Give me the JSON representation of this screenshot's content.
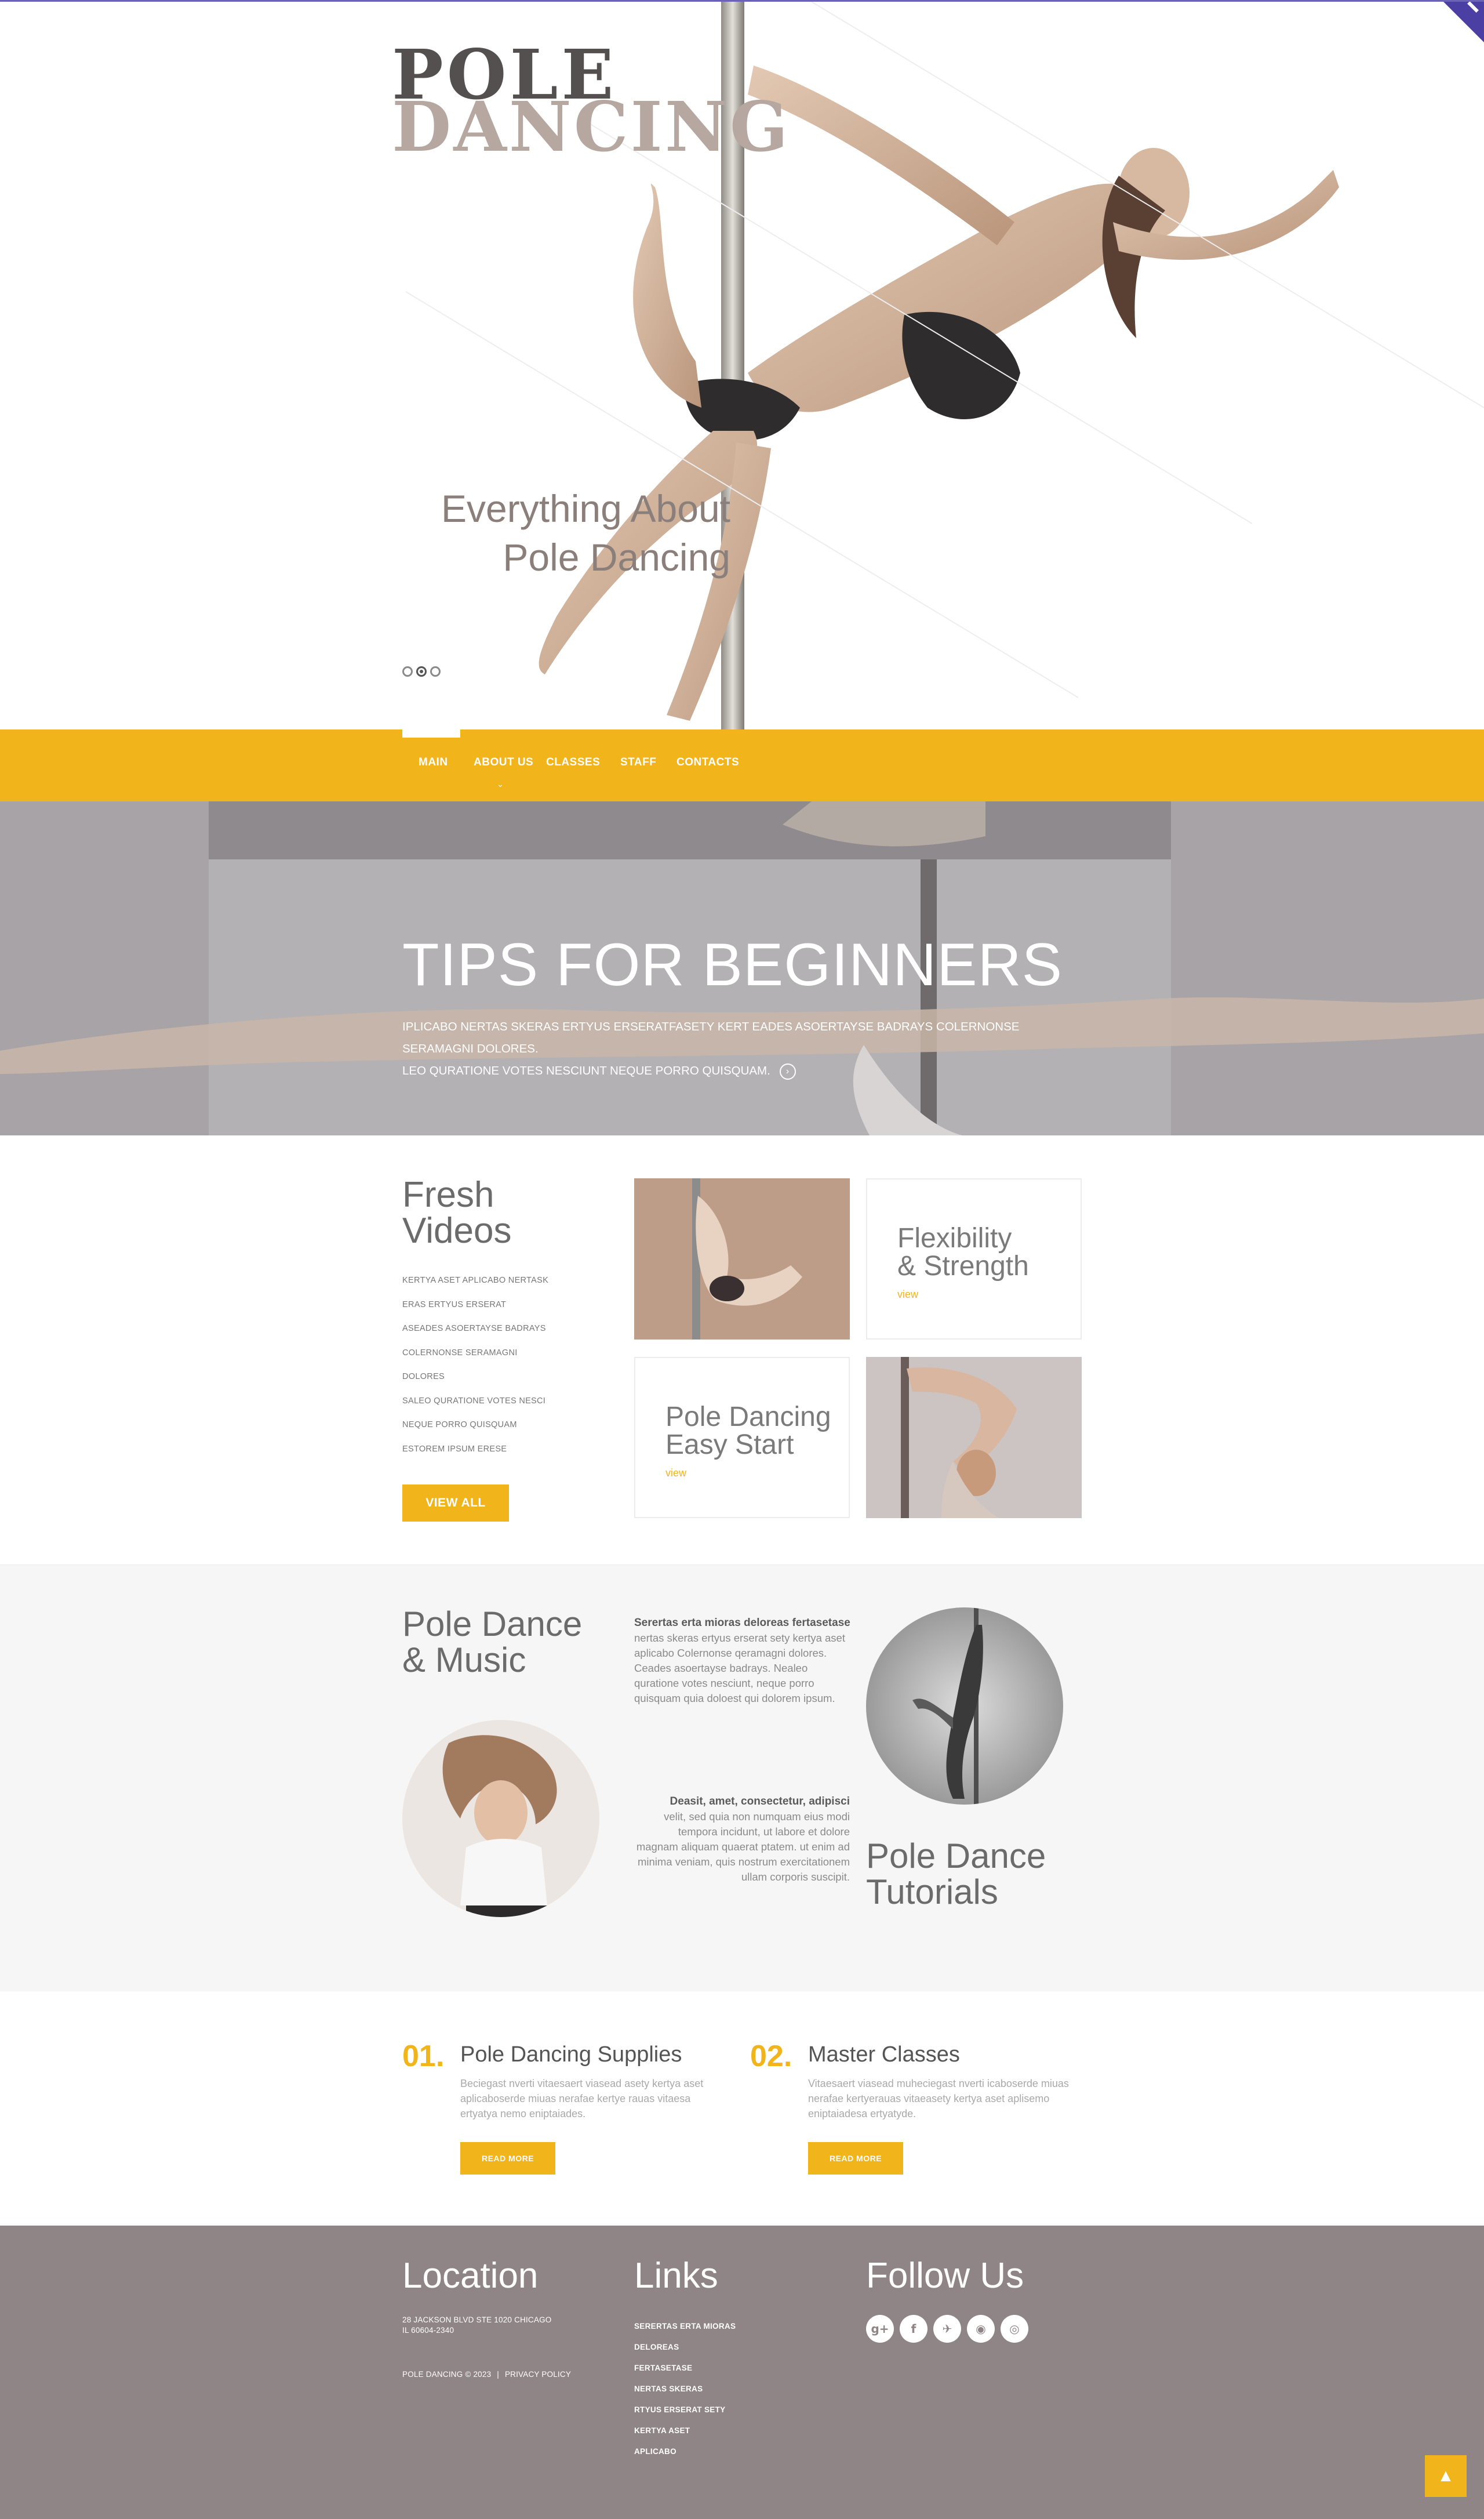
{
  "brand": {
    "logo_line1": "POLE",
    "logo_line2": "DANCING",
    "accent_color": "#f1b51b",
    "footer_color": "#8f8586"
  },
  "hero": {
    "tagline_line1": "Everything About",
    "tagline_line2": "Pole Dancing",
    "slides_total": 3,
    "active_slide": 2
  },
  "nav": {
    "items": [
      "MAIN",
      "ABOUT US",
      "CLASSES",
      "STAFF",
      "CONTACTS"
    ],
    "active": "MAIN"
  },
  "tips": {
    "title": "TIPS FOR BEGINNERS",
    "text_line1": "IPLICABO NERTAS SKERAS ERTYUS ERSERATFASETY KERT EADES ASOERTAYSE BADRAYS COLERNONSE SERAMAGNI DOLORES.",
    "text_line2": "LEO QURATIONE VOTES NESCIUNT NEQUE PORRO QUISQUAM.",
    "more_icon": "arrow-right-icon"
  },
  "fresh_videos": {
    "title_line1": "Fresh",
    "title_line2": "Videos",
    "items": [
      "KERTYA ASET APLICABO NERTASK",
      "ERAS ERTYUS ERSERAT",
      "ASEADES ASOERTAYSE BADRAYS",
      "COLERNONSE SERAMAGNI",
      "DOLORES",
      "SALEO QURATIONE VOTES NESCI",
      "NEQUE PORRO QUISQUAM",
      "ESTOREM IPSUM ERESE"
    ],
    "button": "VIEW ALL",
    "card1": {
      "title_line1": "Flexibility",
      "title_line2": "& Strength",
      "link": "view"
    },
    "card2": {
      "title_line1": "Pole Dancing",
      "title_line2": "Easy Start",
      "link": "view"
    }
  },
  "pole_music": {
    "title_line1": "Pole Dance",
    "title_line2": "& Music",
    "block1_bold": "Serertas erta mioras deloreas fertasetase",
    "block1_text": "nertas skeras ertyus erserat sety kertya aset aplicabo Colernonse qeramagni dolores. Ceades asoertayse badrays. Nealeo quratione votes nesciunt, neque porro quisquam quia doloest qui dolorem ipsum.",
    "block2_bold": "Deasit, amet, consectetur, adipisci",
    "block2_text": "velit, sed quia non numquam eius modi tempora incidunt, ut labore et dolore magnam aliquam quaerat ptatem. ut enim ad minima veniam, quis nostrum exercitationem ullam corporis suscipit.",
    "tutorials_line1": "Pole Dance",
    "tutorials_line2": "Tutorials"
  },
  "services": [
    {
      "number": "01.",
      "title": "Pole Dancing Supplies",
      "text": "Beciegast nverti vitaesaert viasead asety kertya aset aplicaboserde miuas nerafae kertye rauas vitaesa ertyatya nemo eniptaiades.",
      "button": "READ MORE"
    },
    {
      "number": "02.",
      "title": "Master Classes",
      "text": "Vitaesaert viasead muheciegast nverti icaboserde miuas nerafae kertyerauas vitaeasety kertya aset aplisemo eniptaiadesa ertyatyde.",
      "button": "READ MORE"
    }
  ],
  "footer": {
    "location_title": "Location",
    "address_line1": "28 JACKSON BLVD STE 1020 CHICAGO",
    "address_line2": "IL 60604-2340",
    "copyright": "POLE DANCING © 2023",
    "separator": "|",
    "privacy": "PRIVACY POLICY",
    "links_title": "Links",
    "links": [
      "SERERTAS ERTA MIORAS",
      "DELOREAS",
      "FERTASETASE",
      "NERTAS SKERAS",
      "RTYUS ERSERAT SETY",
      "KERTYA ASET",
      "APLICABO"
    ],
    "follow_title": "Follow Us",
    "social": [
      {
        "icon": "google-plus-icon",
        "glyph": "g+"
      },
      {
        "icon": "facebook-icon",
        "glyph": "f"
      },
      {
        "icon": "twitter-icon",
        "glyph": "✈"
      },
      {
        "icon": "rss-icon",
        "glyph": "◉"
      },
      {
        "icon": "dribbble-icon",
        "glyph": "◎"
      }
    ]
  },
  "back_to_top": "▲"
}
